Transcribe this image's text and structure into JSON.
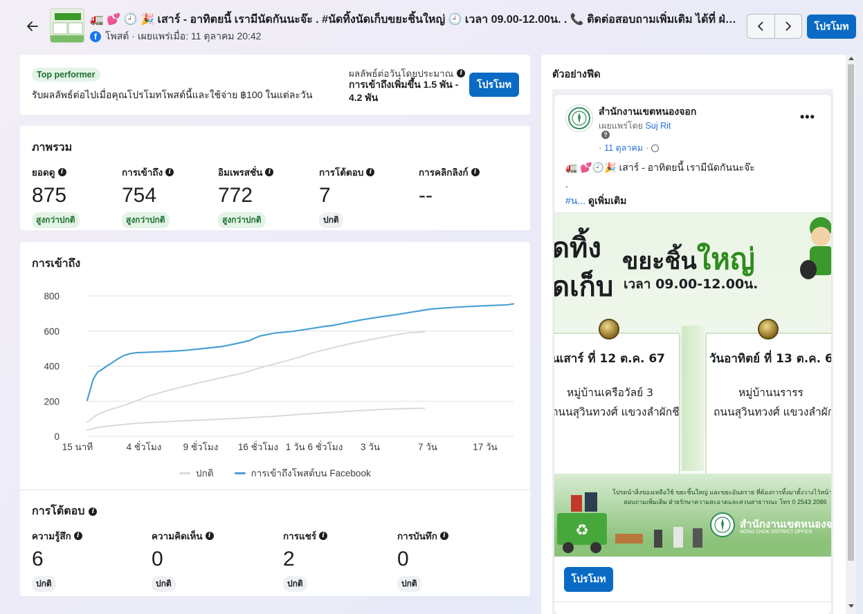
{
  "header": {
    "post_title": "🚛 💕 🕘 🎉 เสาร์ - อาทิตยนี้ เรามีนัดกันนะจ๊ะ . #นัดทิ้งนัดเก็บขยะชิ้นใหญ่ 🕘 เวลา 09.00-12.00น. . 📞 ติดต่อสอบถามเพิ่มเติม ได้ที่ ฝ่ายรักษาความสะอาด",
    "post_meta": "โพสต์ · เผยแพร่เมื่อ: 11 ตุลาคม 20:42",
    "promote_label": "โปรโมท",
    "fb_glyph": "f"
  },
  "top_card": {
    "badge": "Top performer",
    "description": "รับผลลัพธ์ต่อไปเมื่อคุณโปรโมทโพสต์นี้และใช้จ่าย ฿100 ในแต่ละวัน",
    "estimate_label": "ผลลัพธ์ต่อวันโดยประมาณ",
    "estimate_value": "การเข้าถึงเพิ่มขึ้น 1.5 พัน - 4.2 พัน",
    "promote_label": "โปรโมท"
  },
  "overview": {
    "title": "ภาพรวม",
    "metrics": [
      {
        "label": "ยอดดู",
        "value": "875",
        "status": "สูงกว่าปกติ",
        "status_kind": "green"
      },
      {
        "label": "การเข้าถึง",
        "value": "754",
        "status": "สูงกว่าปกติ",
        "status_kind": "green"
      },
      {
        "label": "อิมเพรสชั่น",
        "value": "772",
        "status": "สูงกว่าปกติ",
        "status_kind": "green"
      },
      {
        "label": "การโต้ตอบ",
        "value": "7",
        "status": "ปกติ",
        "status_kind": "gray"
      },
      {
        "label": "การคลิกลิงก์",
        "value": "--",
        "status": "",
        "status_kind": ""
      }
    ]
  },
  "reach": {
    "title": "การเข้าถึง",
    "legend": [
      {
        "name": "ปกติ",
        "color": "#d8dadd"
      },
      {
        "name": "การเข้าถึงโพสต์บน Facebook",
        "color": "#4a9fd6"
      }
    ]
  },
  "chart_data": {
    "type": "line",
    "x_ticks": [
      "15 นาที",
      "4 ชั่วโมง",
      "9 ชั่วโมง",
      "16 ชั่วโมง",
      "1 วัน 6 ชั่วโมง",
      "3 วัน",
      "7 วัน",
      "17 วัน"
    ],
    "ylim": [
      0,
      800
    ],
    "y_ticks": [
      0,
      200,
      400,
      600,
      800
    ],
    "grid": true,
    "legend_position": "bottom",
    "series": [
      {
        "name": "การเข้าถึงโพสต์บน Facebook",
        "color": "#4a9fd6",
        "x_frac": [
          0,
          0.014,
          0.024,
          0.037,
          0.049,
          0.059,
          0.071,
          0.087,
          0.103,
          0.117,
          0.134,
          0.151,
          0.173,
          0.2,
          0.231,
          0.271,
          0.317,
          0.353,
          0.38,
          0.405,
          0.439,
          0.481,
          0.52,
          0.553,
          0.577,
          0.609,
          0.646,
          0.685,
          0.724,
          0.767,
          0.806,
          0.841,
          0.868,
          0.9,
          0.94,
          0.973,
          0.988,
          1.0
        ],
        "values": [
          205,
          325,
          365,
          385,
          405,
          420,
          440,
          462,
          472,
          477,
          478,
          480,
          482,
          485,
          490,
          500,
          512,
          530,
          545,
          572,
          588,
          598,
          612,
          625,
          632,
          648,
          665,
          680,
          693,
          710,
          725,
          732,
          736,
          740,
          745,
          748,
          750,
          755
        ]
      },
      {
        "name": "",
        "color": "#d8dadd",
        "x_frac": [
          0,
          0.024,
          0.049,
          0.078,
          0.113,
          0.145,
          0.18,
          0.223,
          0.271,
          0.317,
          0.365,
          0.405,
          0.451,
          0.493,
          0.535,
          0.577,
          0.621,
          0.668,
          0.715,
          0.755,
          0.791
        ],
        "values": [
          80,
          125,
          148,
          170,
          200,
          230,
          255,
          282,
          310,
          335,
          360,
          390,
          420,
          448,
          480,
          505,
          530,
          552,
          575,
          590,
          595
        ]
      },
      {
        "name": "",
        "color": "#d8dadd",
        "x_frac": [
          0,
          0.024,
          0.049,
          0.08,
          0.113,
          0.159,
          0.204,
          0.259,
          0.317,
          0.38,
          0.439,
          0.493,
          0.546,
          0.609,
          0.668,
          0.724,
          0.791
        ],
        "values": [
          35,
          50,
          58,
          66,
          74,
          80,
          86,
          92,
          98,
          106,
          114,
          124,
          132,
          142,
          150,
          156,
          160
        ]
      }
    ]
  },
  "interaction": {
    "title": "การโต้ตอบ",
    "metrics": [
      {
        "label": "ความรู้สึก",
        "value": "6",
        "status": "ปกติ"
      },
      {
        "label": "ความคิดเห็น",
        "value": "0",
        "status": "ปกติ"
      },
      {
        "label": "การแชร์",
        "value": "2",
        "status": "ปกติ"
      },
      {
        "label": "การบันทึก",
        "value": "0",
        "status": "ปกติ"
      }
    ]
  },
  "preview": {
    "title": "ตัวอย่างฟีด",
    "page_name": "สำนักงานเขตหนองจอก",
    "published_by_prefix": "เผยแพร่โดย",
    "published_by_name": "Suj Rit",
    "date_prefix": "·",
    "date": "11 ตุลาคม",
    "date_suffix": "·",
    "question_glyph": "?",
    "more_glyph": "•••",
    "post_line1": "🚛 💕🕘🎉 เสาร์ - อาทิตยนี้ เรามีนัดกันนะจ๊ะ",
    "post_line2": ".",
    "hashtag": "#น...",
    "see_more": "ดูเพิ่มเติม",
    "promote_label": "โปรโมท",
    "image": {
      "headline_left_1": "ัดทิ้ง",
      "headline_left_2": "ัดเก็บ",
      "headline_right_a": "ขยะชิ้น",
      "headline_right_b": "ใหญ่",
      "time_text": "เวลา 09.00-12.00น.",
      "day1_title": "ันเสาร์ ที่ 12 ต.ค. 67",
      "day1_line1": "หมู่บ้านเครือวัลย์ 3",
      "day1_line2": "ถนนสุวินทวงศ์ แขวงลำผักชี",
      "day2_title": "วันอาทิตย์ ที่ 13 ต.ค. 6",
      "day2_line1": "หมู่บ้านนรารร",
      "day2_line2": "ถนนสุวินทวงศ์ แขวงลำผักชี",
      "band_line1": "โปรดนำสิ่งของเหลือใช้ ขยะชิ้นใหญ่ และขยะอันตราย ที่ต้องการทิ้งมาตั้งวางไว้หน้าบ้านก่อน",
      "band_line2": "สอบถามเพิ่มเติม ฝ่ายรักษาความสะอาดและสวนสาธารณะ โทร 0 2543 2086",
      "org_name": "สำนักงานเขตหนองจอ",
      "org_sub": "NONG CHOK DISTRICT OFFICE",
      "recycle_glyph": "♻"
    }
  }
}
